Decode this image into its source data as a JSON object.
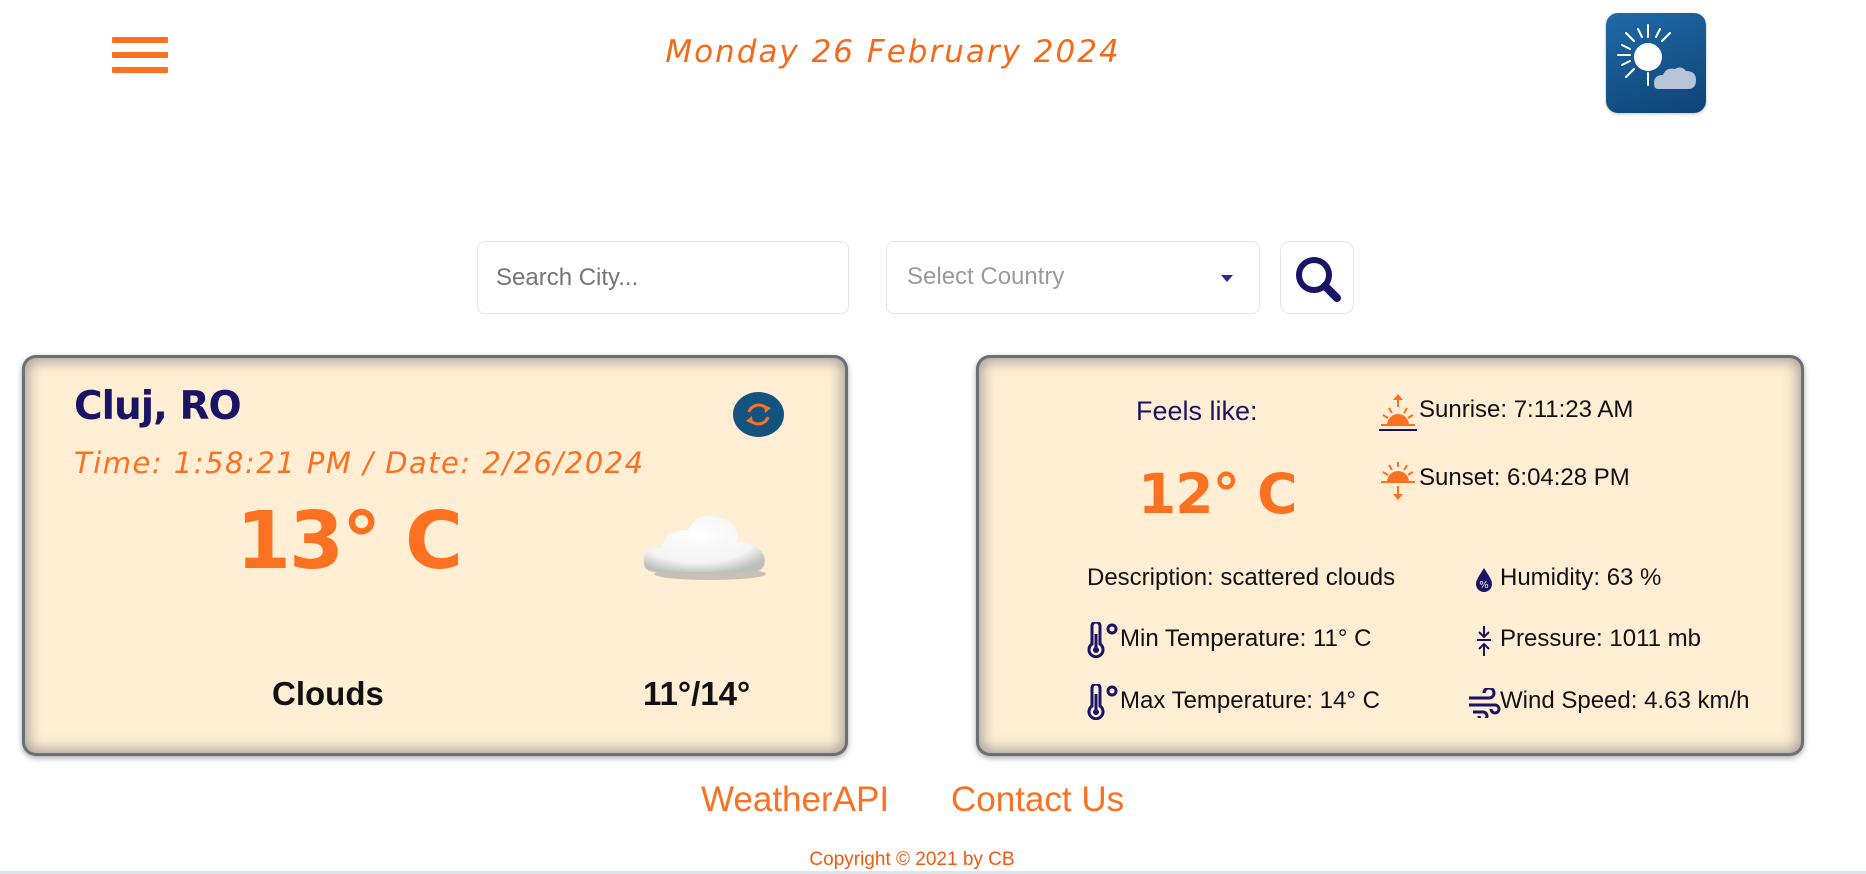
{
  "header": {
    "date": "Monday 26 February 2024"
  },
  "search": {
    "city_placeholder": "Search City...",
    "country_placeholder": "Select Country"
  },
  "current": {
    "city": "Cluj, RO",
    "time_date": "Time: 1:58:21 PM / Date: 2/26/2024",
    "temperature": "13° C",
    "condition": "Clouds",
    "min_max": "11°/14°"
  },
  "details": {
    "feels_like_label": "Feels like:",
    "feels_like_value": "12° C",
    "sunrise": "Sunrise: 7:11:23 AM",
    "sunset": "Sunset: 6:04:28 PM",
    "description": "Description: scattered clouds",
    "humidity": "Humidity: 63 %",
    "min_temp": "Min Temperature: 11° C",
    "pressure": "Pressure: 1011 mb",
    "max_temp": "Max Temperature: 14° C",
    "wind": "Wind Speed: 4.63 km/h"
  },
  "footer": {
    "link_api": "WeatherAPI",
    "link_contact": "Contact Us",
    "copyright": "Copyright © 2021 by CB"
  },
  "colors": {
    "accent_orange": "#fb7122",
    "navy": "#1a1466",
    "card_bg": "#ffeed3",
    "logo_blue": "#14537f"
  },
  "icons": [
    "menu-icon",
    "sun-cloud-logo-icon",
    "search-icon",
    "refresh-icon",
    "cloud-icon",
    "sunrise-icon",
    "sunset-icon",
    "humidity-icon",
    "thermometer-icon",
    "pressure-icon",
    "wind-icon"
  ]
}
